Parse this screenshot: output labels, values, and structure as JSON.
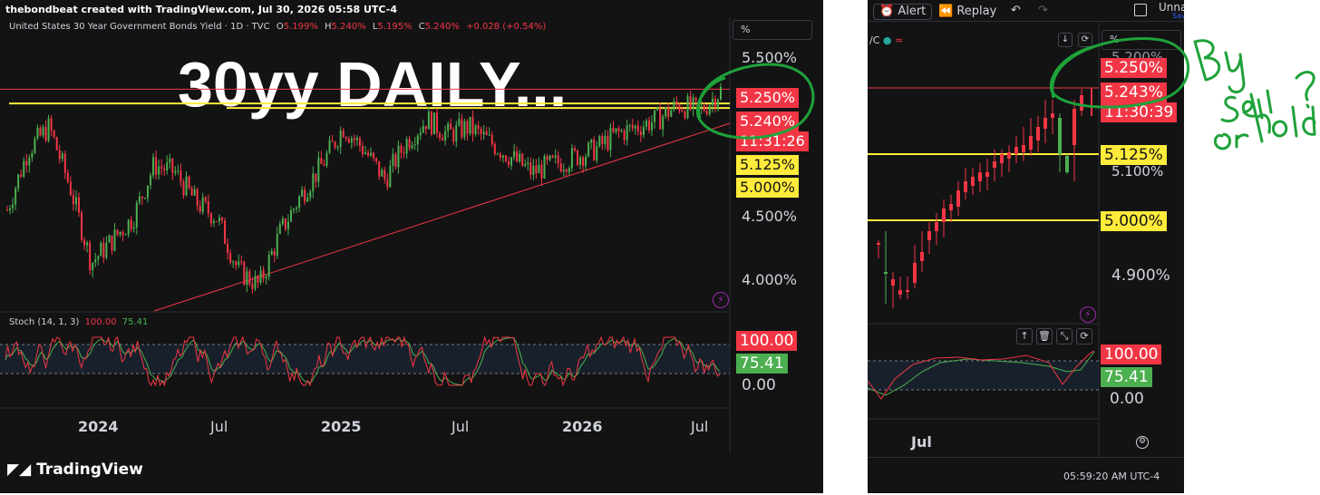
{
  "left": {
    "credit": "thebondbeat created with TradingView.com, Jul 30, 2026 05:58 UTC-4",
    "symbol": "United States 30 Year Government Bonds Yield · 1D · TVC",
    "ohlc": {
      "o_label": "O",
      "o_value": "5.199%",
      "h_label": "H",
      "h_value": "5.240%",
      "l_label": "L",
      "l_value": "5.195%",
      "c_label": "C",
      "c_value": "5.240%",
      "change": "+0.028 (+0.54%)"
    },
    "percent_button": "%",
    "headline": "30yy DAILY...",
    "indicator_label": "Stoch (14, 1, 3)",
    "indicator_k": "100.00",
    "indicator_d": "75.41",
    "brand": "TradingView",
    "accent_red": "#f23645",
    "accent_green": "#4caf50",
    "accent_yellow": "#ffeb3b"
  },
  "right": {
    "toolbar": {
      "alert": "Alert",
      "replay": "Replay",
      "name_stub": "Unna",
      "save_stub": "Sav"
    },
    "symbol_stub": "/C",
    "percent_button": "%",
    "clock": "05:59:20 AM UTC-4"
  },
  "annotation": {
    "text": "Buy sell or hold?"
  },
  "chart_data": [
    {
      "type": "line",
      "title": "30yy DAILY...",
      "series": [
        {
          "name": "United States 30 Year Government Bonds Yield",
          "x": [
            "2023-09",
            "2023-10",
            "2023-11",
            "2023-12",
            "2024-01",
            "2024-02",
            "2024-03",
            "2024-04",
            "2024-05",
            "2024-06",
            "2024-07",
            "2024-08",
            "2024-09",
            "2024-10",
            "2024-11",
            "2024-12",
            "2025-01",
            "2025-02",
            "2025-03",
            "2025-04",
            "2025-05",
            "2025-06",
            "2025-07",
            "2025-08",
            "2025-09",
            "2025-10",
            "2025-11",
            "2025-12",
            "2026-01",
            "2026-02",
            "2026-03",
            "2026-04",
            "2026-05",
            "2026-06",
            "2026-07"
          ],
          "values": [
            4.45,
            4.85,
            5.0,
            4.6,
            4.1,
            4.25,
            4.4,
            4.75,
            4.7,
            4.5,
            4.4,
            4.05,
            3.95,
            4.3,
            4.55,
            4.75,
            5.0,
            4.85,
            4.65,
            4.9,
            5.05,
            4.95,
            5.0,
            4.9,
            4.8,
            4.7,
            4.75,
            4.8,
            4.85,
            4.95,
            5.0,
            5.05,
            5.15,
            5.1,
            5.24
          ]
        }
      ],
      "x_ticks": [
        "2024",
        "Jul",
        "2025",
        "Jul",
        "2026",
        "Jul"
      ],
      "y_ticks": [
        "4.000%",
        "4.500%",
        "5.000%",
        "5.500%"
      ],
      "ylim": [
        3.8,
        5.6
      ],
      "price_labels": [
        "5.250%",
        "5.240%",
        "11:31:26",
        "5.125%",
        "5.000%"
      ],
      "horizontal_levels": [
        5.25,
        5.155,
        5.125
      ],
      "trendline": {
        "from": [
          "2024-09",
          3.95
        ],
        "to": [
          "2026-07",
          5.0
        ]
      }
    },
    {
      "type": "line",
      "title": "Stoch (14, 1, 3)",
      "series": [
        {
          "name": "K",
          "values": [
            100.0
          ]
        },
        {
          "name": "D",
          "values": [
            75.41
          ]
        }
      ],
      "y_ticks": [
        "0.00",
        "100.00",
        "75.41"
      ],
      "ylim": [
        0,
        100
      ]
    },
    {
      "type": "line",
      "series": [
        {
          "name": "Yield (zoomed)",
          "x": [
            "Jul 1",
            "Jul 3",
            "Jul 6",
            "Jul 8",
            "Jul 10",
            "Jul 13",
            "Jul 15",
            "Jul 17",
            "Jul 20",
            "Jul 22",
            "Jul 24",
            "Jul 27",
            "Jul 29",
            "Jul 30"
          ],
          "values": [
            4.88,
            4.89,
            4.95,
            5.0,
            5.05,
            5.1,
            5.11,
            5.12,
            5.1,
            5.15,
            5.18,
            5.12,
            5.1,
            5.243
          ]
        }
      ],
      "x_ticks": [
        "Jul"
      ],
      "y_ticks": [
        "4.900%",
        "5.100%",
        "5.200%"
      ],
      "ylim": [
        4.85,
        5.3
      ],
      "price_labels": [
        "5.250%",
        "5.243%",
        "11:30:39",
        "5.125%",
        "5.000%"
      ],
      "horizontal_levels": [
        5.25,
        5.125,
        5.0
      ]
    },
    {
      "type": "line",
      "title": "",
      "series": [
        {
          "name": "K",
          "values": [
            100.0
          ]
        },
        {
          "name": "D",
          "values": [
            75.41
          ]
        }
      ],
      "y_ticks": [
        "100.00",
        "75.41",
        "0.00"
      ],
      "ylim": [
        0,
        100
      ]
    }
  ]
}
